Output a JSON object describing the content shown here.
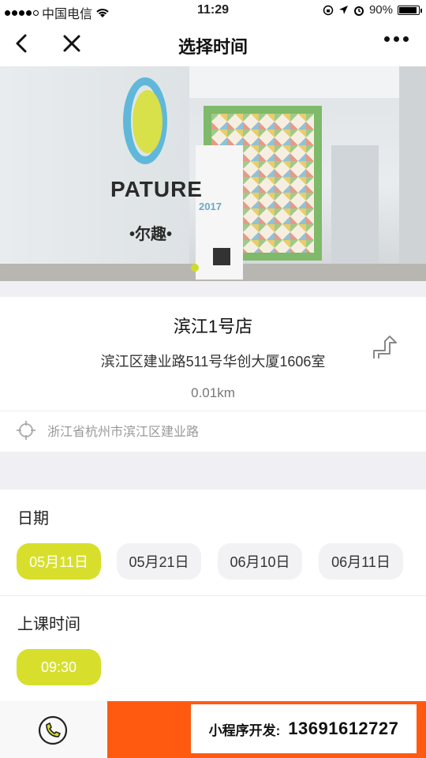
{
  "status_bar": {
    "carrier": "中国电信",
    "time": "11:29",
    "battery": "90%",
    "battery_level": 0.9
  },
  "nav": {
    "title": "选择时间",
    "back_icon": "chevron-left-icon",
    "close_icon": "close-icon",
    "more_icon": "more-icon"
  },
  "banner": {
    "logo_text": "PATURE",
    "logo_sub": "•尔趣•",
    "standee_year": "2017",
    "slide_index": 1
  },
  "store": {
    "name": "滨江1号店",
    "address": "滨江区建业路511号华创大厦1606室",
    "distance": "0.01km",
    "location": "浙江省杭州市滨江区建业路"
  },
  "dates_section": {
    "title": "日期",
    "dates": [
      "05月11日",
      "05月21日",
      "06月10日",
      "06月11日"
    ],
    "selected_index": 0
  },
  "time_section": {
    "title": "上课时间",
    "times": [
      "09:30"
    ],
    "selected_index": 0
  },
  "bottom": {
    "phone_icon": "phone-icon",
    "promo_label": "小程序开发:",
    "promo_number": "13691612727"
  },
  "colors": {
    "accent": "#d7df2c",
    "orange": "#ff5a10"
  }
}
